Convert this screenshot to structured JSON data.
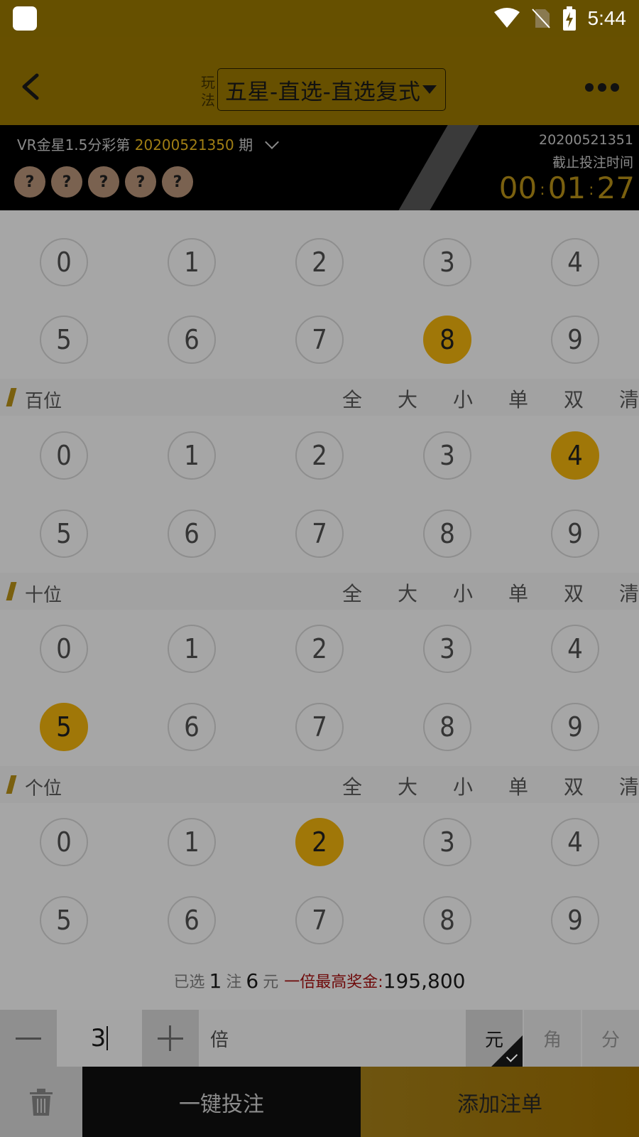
{
  "status": {
    "time": "5:44",
    "icons": [
      "wifi-icon",
      "no-sim-icon",
      "battery-charging-icon"
    ]
  },
  "header": {
    "play_label_top": "玩",
    "play_label_bottom": "法",
    "play_mode": "五星-直选-直选复式"
  },
  "draw": {
    "lottery_prefix": "VR金星1.5分彩第",
    "issue": "20200521350",
    "issue_suffix": "期",
    "result_balls": [
      "?",
      "?",
      "?",
      "?",
      "?"
    ],
    "next_issue": "20200521351",
    "deadline_label": "截止投注时间",
    "countdown": {
      "hh": "00",
      "mm": "01",
      "ss": "27"
    }
  },
  "quick_options": [
    "全",
    "大",
    "小",
    "单",
    "双",
    "清"
  ],
  "rows": [
    {
      "label": "",
      "selected": [
        8
      ]
    },
    {
      "label": "百位",
      "selected": [
        4
      ]
    },
    {
      "label": "十位",
      "selected": [
        5
      ]
    },
    {
      "label": "个位",
      "selected": [
        2
      ]
    }
  ],
  "summary": {
    "prefix": "已选",
    "bets": "1",
    "bets_unit": "注",
    "amount": "6",
    "amount_unit": "元",
    "prize_label": "一倍最高奖金:",
    "prize": "195,800"
  },
  "multiplier": {
    "value": "3",
    "unit": "倍"
  },
  "units": [
    "元",
    "角",
    "分"
  ],
  "actions": {
    "one_key": "一键投注",
    "add": "添加注单"
  },
  "colors": {
    "brand": "#675000",
    "selected_ball": "#a07708",
    "countdown": "#7a600f"
  }
}
